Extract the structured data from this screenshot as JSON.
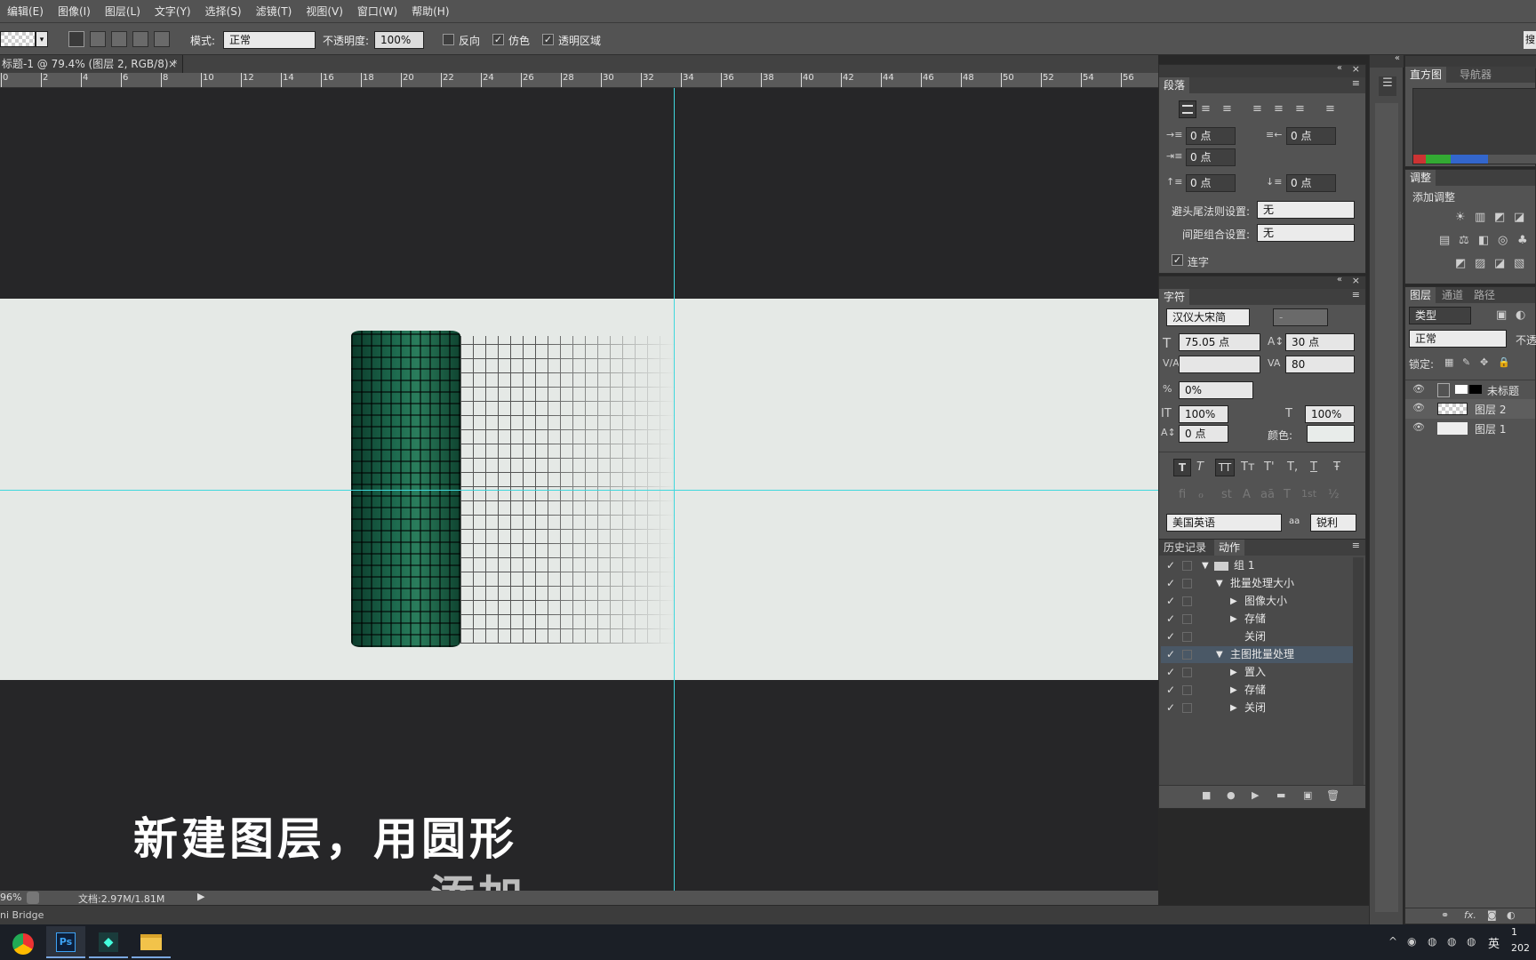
{
  "menu": [
    "编辑(E)",
    "图像(I)",
    "图层(L)",
    "文字(Y)",
    "选择(S)",
    "滤镜(T)",
    "视图(V)",
    "窗口(W)",
    "帮助(H)"
  ],
  "options": {
    "mode_label": "模式:",
    "mode_value": "正常",
    "opacity_label": "不透明度:",
    "opacity_value": "100%",
    "reverse_label": "反向",
    "dither_label": "仿色",
    "transparency_label": "透明区域",
    "right_btn": "搜"
  },
  "doc_tab": "标题-1 @ 79.4% (图层 2, RGB/8) *",
  "ruler_ticks": [
    "0",
    "2",
    "4",
    "6",
    "8",
    "10",
    "12",
    "14",
    "16",
    "18",
    "20",
    "22",
    "24",
    "26",
    "28",
    "30",
    "32",
    "34",
    "36",
    "38",
    "40",
    "42",
    "44",
    "46",
    "48",
    "50",
    "52",
    "54",
    "56"
  ],
  "subtitle": {
    "line1": "新建图层，用圆形",
    "line2": "添加"
  },
  "status": {
    "zoom": "96%",
    "doc": "文档:2.97M/1.81M"
  },
  "bridge": "ni Bridge",
  "paragraph": {
    "tab": "段落",
    "indent_left": "0 点",
    "indent_right": "0 点",
    "indent_first": "0 点",
    "space_before": "0 点",
    "space_after": "0 点",
    "kinsoku_label": "避头尾法则设置:",
    "kinsoku_value": "无",
    "mojikumi_label": "间距组合设置:",
    "mojikumi_value": "无",
    "hyphen_label": "连字"
  },
  "character": {
    "tab": "字符",
    "font": "汉仪大宋简",
    "style": "-",
    "size": "75.05 点",
    "leading": "30 点",
    "kerning": "",
    "tracking": "80",
    "tsume": "0%",
    "vscale": "100%",
    "hscale": "100%",
    "baseline": "0 点",
    "color_label": "颜色:",
    "language": "美国英语",
    "aa_label": "aa",
    "aa_value": "锐利",
    "style_buttons": [
      "T",
      "T",
      "TT",
      "Tт",
      "T'",
      "T,",
      "T",
      "Ŧ"
    ],
    "ot_buttons": [
      "fi",
      "ℴ",
      "st",
      "A",
      "aā",
      "T",
      "1st",
      "½"
    ]
  },
  "actions": {
    "tabs": [
      "历史记录",
      "动作"
    ],
    "rows": [
      {
        "label": "组 1",
        "level": 0,
        "kind": "folder",
        "highlight": false
      },
      {
        "label": "批量处理大小",
        "level": 1,
        "kind": "expanded",
        "highlight": false
      },
      {
        "label": "图像大小",
        "level": 2,
        "kind": "collapsed",
        "highlight": false
      },
      {
        "label": "存储",
        "level": 2,
        "kind": "collapsed",
        "highlight": false
      },
      {
        "label": "关闭",
        "level": 2,
        "kind": "none",
        "highlight": false
      },
      {
        "label": "主图批量处理",
        "level": 1,
        "kind": "expanded",
        "highlight": true
      },
      {
        "label": "置入",
        "level": 2,
        "kind": "collapsed",
        "highlight": false
      },
      {
        "label": "存储",
        "level": 2,
        "kind": "collapsed",
        "highlight": false
      },
      {
        "label": "关闭",
        "level": 2,
        "kind": "collapsed",
        "highlight": false
      }
    ]
  },
  "right": {
    "histo_tabs": [
      "直方图",
      "导航器"
    ],
    "adjust_tab": "调整",
    "adjust_add": "添加调整",
    "layers_tabs": [
      "图层",
      "通道",
      "路径"
    ],
    "filter_kind": "类型",
    "blend": "正常",
    "opacity_short": "不透",
    "lock_label": "锁定:",
    "layers": [
      {
        "name": "未标题"
      },
      {
        "name": "图层 2"
      },
      {
        "name": "图层 1"
      }
    ]
  },
  "tray": {
    "ime": "英",
    "time": "1",
    "date": "202"
  },
  "colors": {
    "guide": "#3fd7dd",
    "panel": "#535353",
    "highlight": "#4a5866"
  }
}
